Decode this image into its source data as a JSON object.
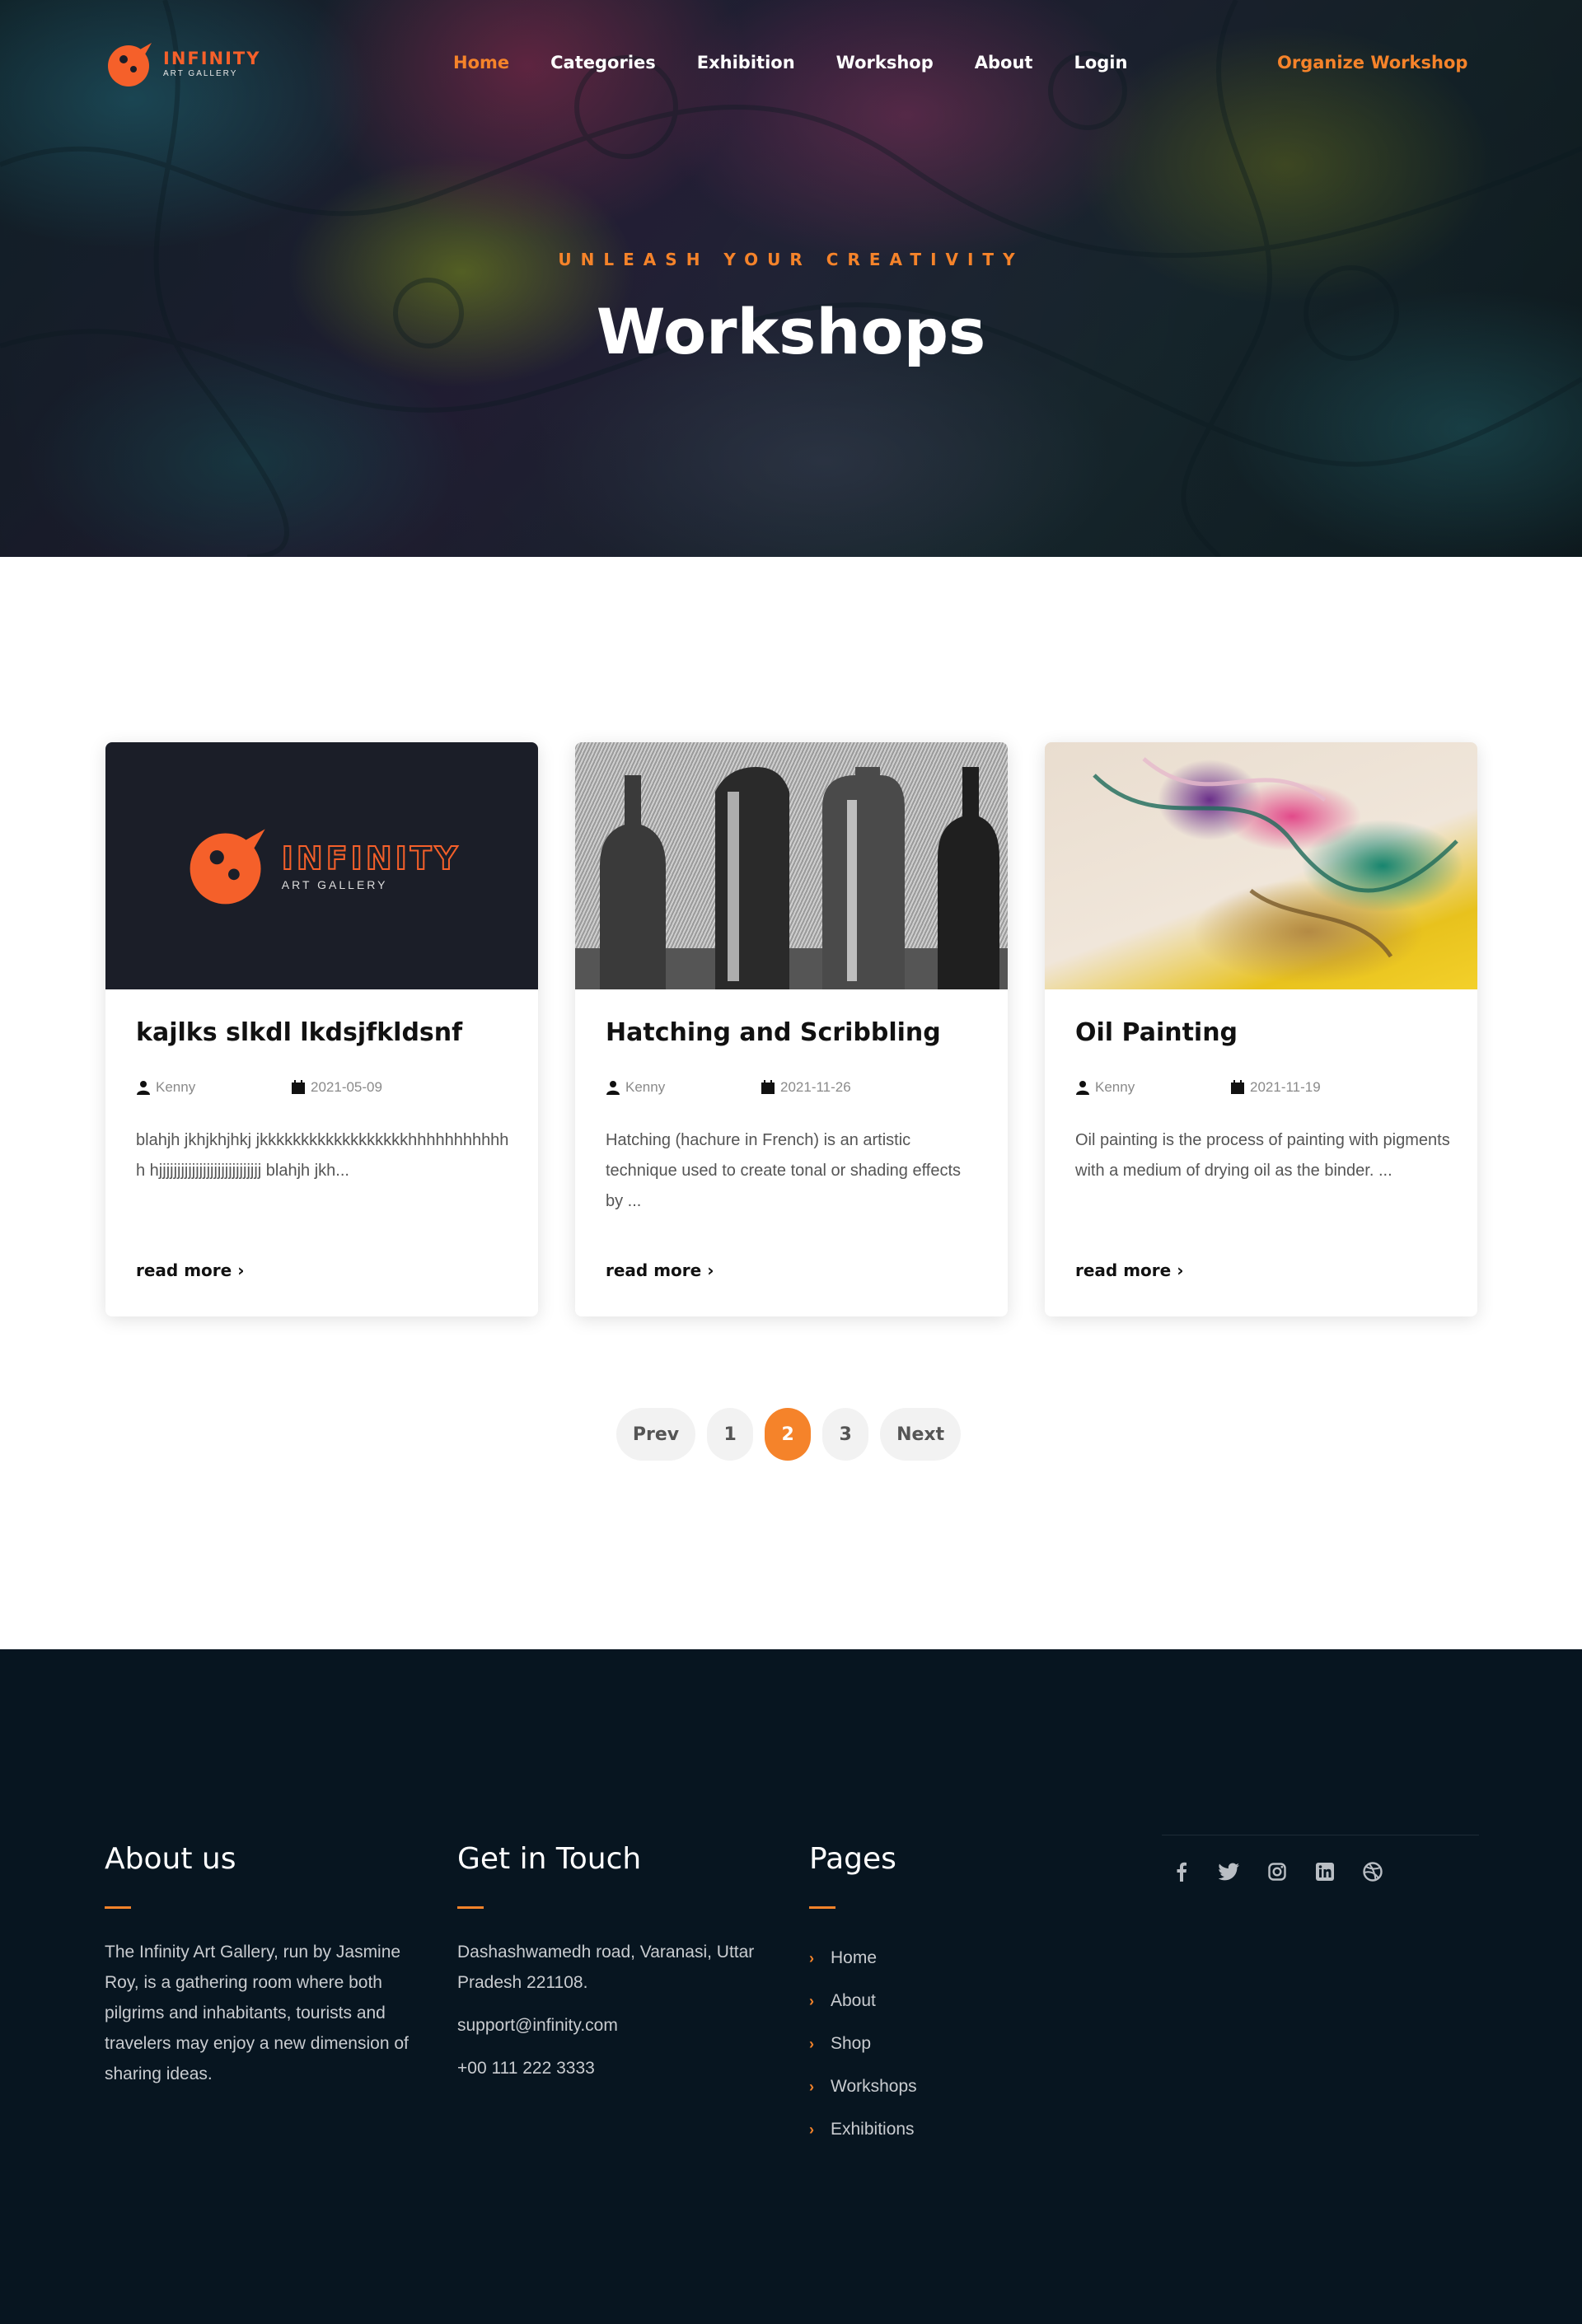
{
  "brand": {
    "title": "INFINITY",
    "subtitle": "ART GALLERY"
  },
  "nav": {
    "items": [
      {
        "label": "Home",
        "active": true
      },
      {
        "label": "Categories"
      },
      {
        "label": "Exhibition"
      },
      {
        "label": "Workshop"
      },
      {
        "label": "About"
      },
      {
        "label": "Login"
      }
    ],
    "cta": "Organize Workshop"
  },
  "hero": {
    "subtitle": "UNLEASH YOUR CREATIVITY",
    "title": "Workshops"
  },
  "cards": [
    {
      "title": "kajlks slkdl lkdsjfkldsnf",
      "author": "Kenny",
      "date": "2021-05-09",
      "excerpt": "blahjh jkhjkhjhkj jkkkkkkkkkkkkkkkkkkhhhhhhhhhhhh hjjjjjjjjjjjjjjjjjjjjjjjjjjjj blahjh jkh...",
      "read_more": "read more"
    },
    {
      "title": "Hatching and Scribbling",
      "author": "Kenny",
      "date": "2021-11-26",
      "excerpt": "Hatching (hachure in French) is an artistic technique used to create tonal or shading effects by ...",
      "read_more": "read more"
    },
    {
      "title": "Oil Painting",
      "author": "Kenny",
      "date": "2021-11-19",
      "excerpt": "Oil painting is the process of painting with pigments with a medium of drying oil as the binder. ...",
      "read_more": "read more"
    }
  ],
  "pagination": {
    "prev": "Prev",
    "pages": [
      "1",
      "2",
      "3"
    ],
    "current": "2",
    "next": "Next"
  },
  "footer": {
    "about": {
      "heading": "About us",
      "text": "The Infinity Art Gallery, run by Jasmine Roy, is a gathering room where both pilgrims and inhabitants, tourists and travelers may enjoy a new dimension of sharing ideas."
    },
    "contact": {
      "heading": "Get in Touch",
      "address": "Dashashwamedh road, Varanasi, Uttar Pradesh 221108.",
      "email": "support@infinity.com",
      "phone": "+00 111 222 3333"
    },
    "pages": {
      "heading": "Pages",
      "links": [
        "Home",
        "About",
        "Shop",
        "Workshops",
        "Exhibitions"
      ]
    },
    "social": [
      "facebook-icon",
      "twitter-icon",
      "instagram-icon",
      "linkedin-icon",
      "dribbble-icon"
    ]
  },
  "colors": {
    "accent": "#f5832a",
    "logo": "#f5602a",
    "footer_bg": "#071520",
    "card_dark": "#1b1e28"
  }
}
